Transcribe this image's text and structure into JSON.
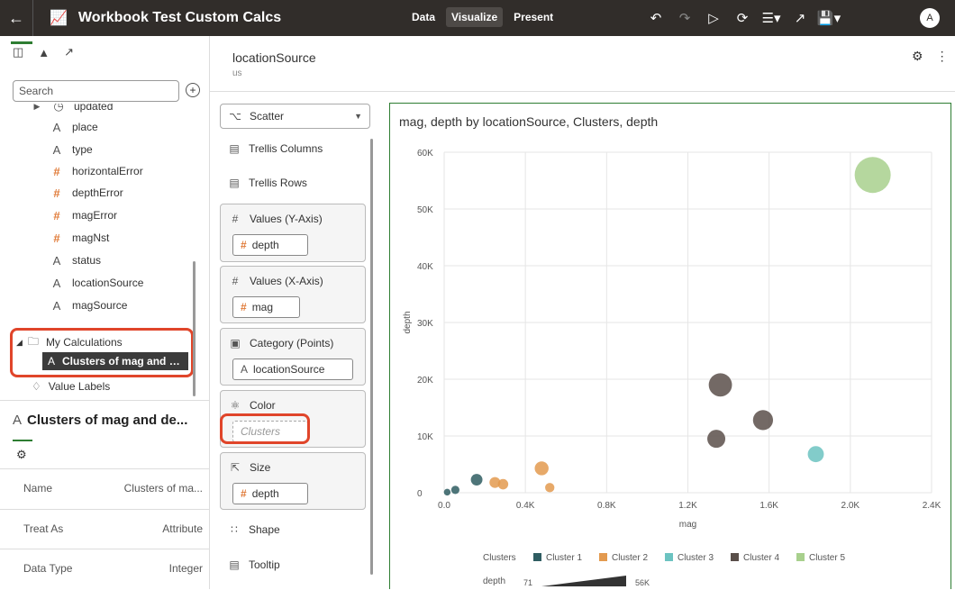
{
  "app": {
    "title": "Workbook Test Custom Calcs",
    "tabs": [
      {
        "label": "Data",
        "active": false
      },
      {
        "label": "Visualize",
        "active": true
      },
      {
        "label": "Present",
        "active": false
      }
    ],
    "avatar": "A"
  },
  "left_panel": {
    "search_placeholder": "Search",
    "tree": [
      {
        "type": "clock",
        "label": "updated"
      },
      {
        "type": "A",
        "label": "place"
      },
      {
        "type": "A",
        "label": "type"
      },
      {
        "type": "#",
        "label": "horizontalError"
      },
      {
        "type": "#",
        "label": "depthError"
      },
      {
        "type": "#",
        "label": "magError"
      },
      {
        "type": "#",
        "label": "magNst"
      },
      {
        "type": "A",
        "label": "status"
      },
      {
        "type": "A",
        "label": "locationSource"
      },
      {
        "type": "A",
        "label": "magSource"
      }
    ],
    "folder_label": "My Calculations",
    "selected_calc": "Clusters of mag and …",
    "value_labels": "Value Labels"
  },
  "properties": {
    "title": "Clusters of mag and de...",
    "rows": [
      {
        "label": "Name",
        "value": "Clusters of ma..."
      },
      {
        "label": "Treat As",
        "value": "Attribute"
      },
      {
        "label": "Data Type",
        "value": "Integer"
      }
    ]
  },
  "header": {
    "title": "locationSource",
    "subtitle": "us"
  },
  "grammar": {
    "chart_type": "Scatter",
    "trellis_columns": "Trellis Columns",
    "trellis_rows": "Trellis Rows",
    "values_y": {
      "label": "Values (Y-Axis)",
      "item": "depth"
    },
    "values_x": {
      "label": "Values (X-Axis)",
      "item": "mag"
    },
    "category": {
      "label": "Category (Points)",
      "item": "locationSource"
    },
    "color": {
      "label": "Color",
      "item": "Clusters"
    },
    "size": {
      "label": "Size",
      "item": "depth"
    },
    "shape": "Shape",
    "tooltip": "Tooltip"
  },
  "chart_data": {
    "type": "scatter",
    "title": "mag, depth by locationSource, Clusters, depth",
    "xlabel": "mag",
    "ylabel": "depth",
    "xlim": [
      0,
      2400
    ],
    "ylim": [
      0,
      60000
    ],
    "x_ticks": [
      "0.0",
      "0.4K",
      "0.8K",
      "1.2K",
      "1.6K",
      "2.0K",
      "2.4K"
    ],
    "y_ticks": [
      "0",
      "10K",
      "20K",
      "30K",
      "40K",
      "50K",
      "60K"
    ],
    "grid": true,
    "legend_title": "Clusters",
    "legend_placement": "bottom",
    "size_legend": {
      "label": "depth",
      "min": "71",
      "max": "56K"
    },
    "series": [
      {
        "name": "Cluster 1",
        "color": "#2f5d62",
        "points": [
          {
            "x": 15,
            "y": 100
          },
          {
            "x": 55,
            "y": 500
          },
          {
            "x": 160,
            "y": 2300
          }
        ]
      },
      {
        "name": "Cluster 2",
        "color": "#e39a4f",
        "points": [
          {
            "x": 250,
            "y": 1800
          },
          {
            "x": 290,
            "y": 1500
          },
          {
            "x": 480,
            "y": 4300
          },
          {
            "x": 520,
            "y": 900
          }
        ]
      },
      {
        "name": "Cluster 3",
        "color": "#6cc3c1",
        "points": [
          {
            "x": 1830,
            "y": 6800
          }
        ]
      },
      {
        "name": "Cluster 4",
        "color": "#5a4f4a",
        "points": [
          {
            "x": 1340,
            "y": 9500
          },
          {
            "x": 1360,
            "y": 19000
          },
          {
            "x": 1570,
            "y": 12800
          }
        ]
      },
      {
        "name": "Cluster 5",
        "color": "#a8d08d",
        "points": [
          {
            "x": 2110,
            "y": 56000
          }
        ]
      }
    ]
  }
}
